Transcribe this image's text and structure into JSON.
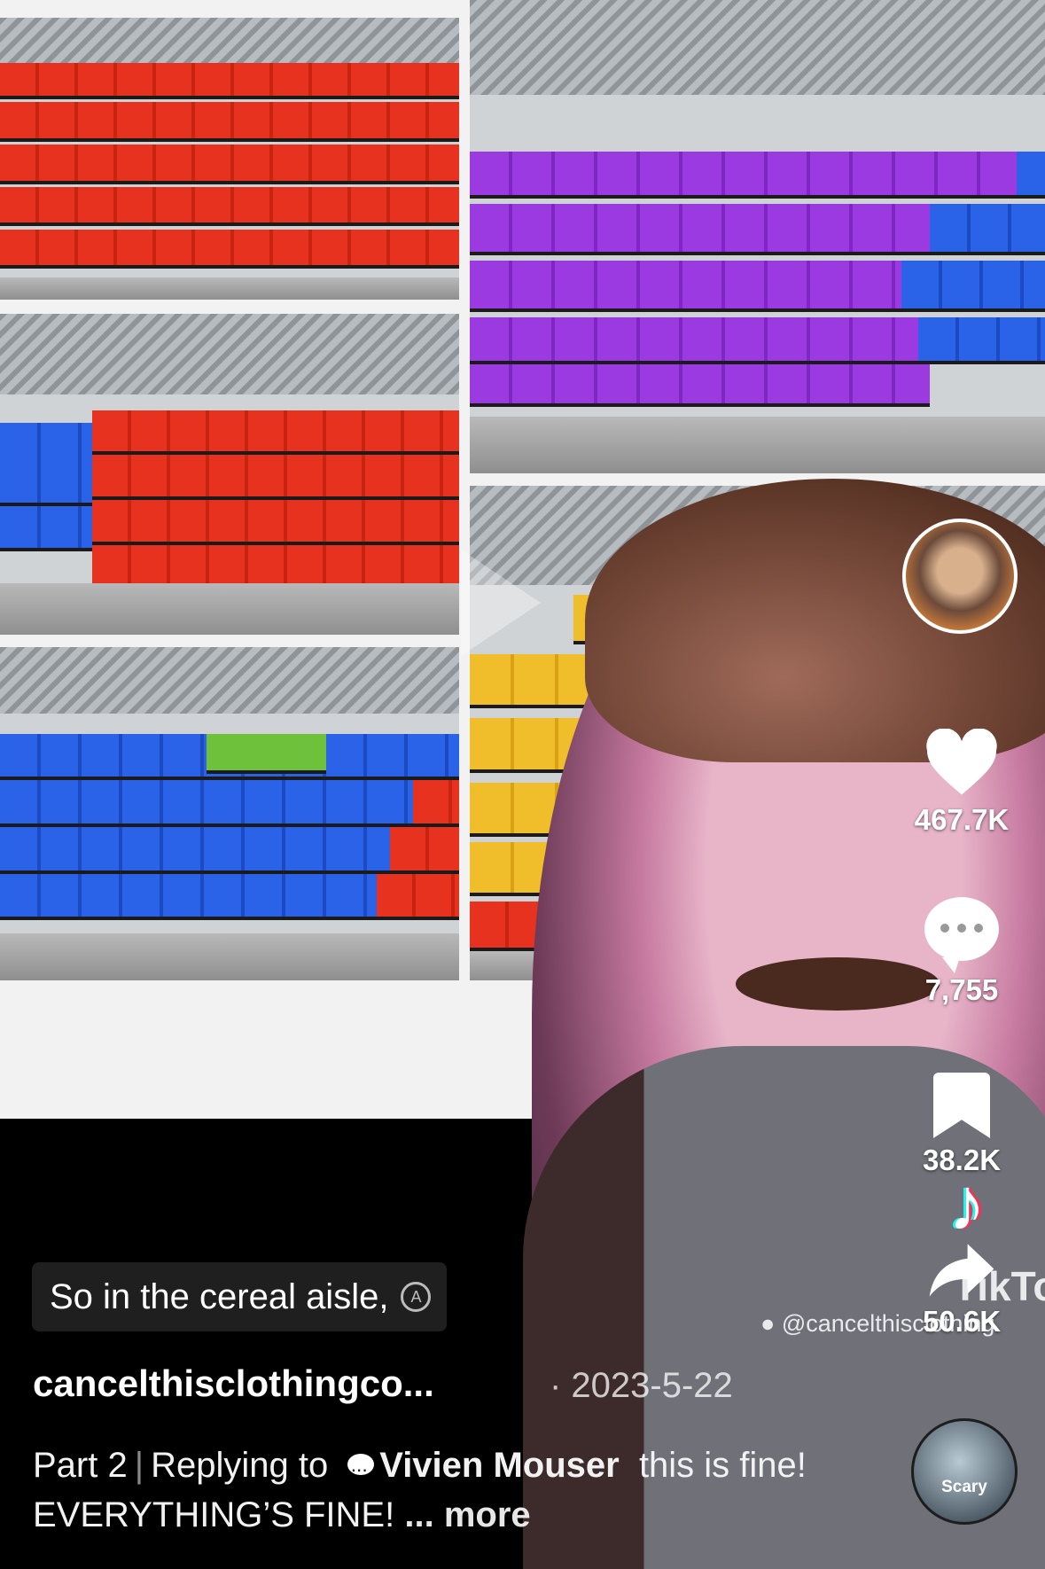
{
  "rail": {
    "likes": "467.7K",
    "comments": "7,755",
    "saves": "38.2K",
    "shares": "50.6K",
    "avatar_icon": "creator-avatar",
    "sound_label": "Scary"
  },
  "overlay": {
    "watermark_handle": "@cancelthisclothing",
    "brand_word": "TikTo",
    "logo_glyph": "♪"
  },
  "caption": {
    "text": "So in the cereal aisle,",
    "translate_glyph": "A"
  },
  "post": {
    "author": "cancelthisclothingco...",
    "date": "· 2023-5-22",
    "part": "Part 2",
    "separator": "|",
    "replying_to": "Replying to",
    "reply_name": "Vivien Mouser",
    "description": "this is fine! EVERYTHING’S FINE!",
    "more": "... more"
  },
  "colors": {
    "like": "#ffffff",
    "tiktok_cyan": "#25f4ee",
    "tiktok_red": "#fe2c55",
    "caption_bg": "#1f1f1f"
  }
}
